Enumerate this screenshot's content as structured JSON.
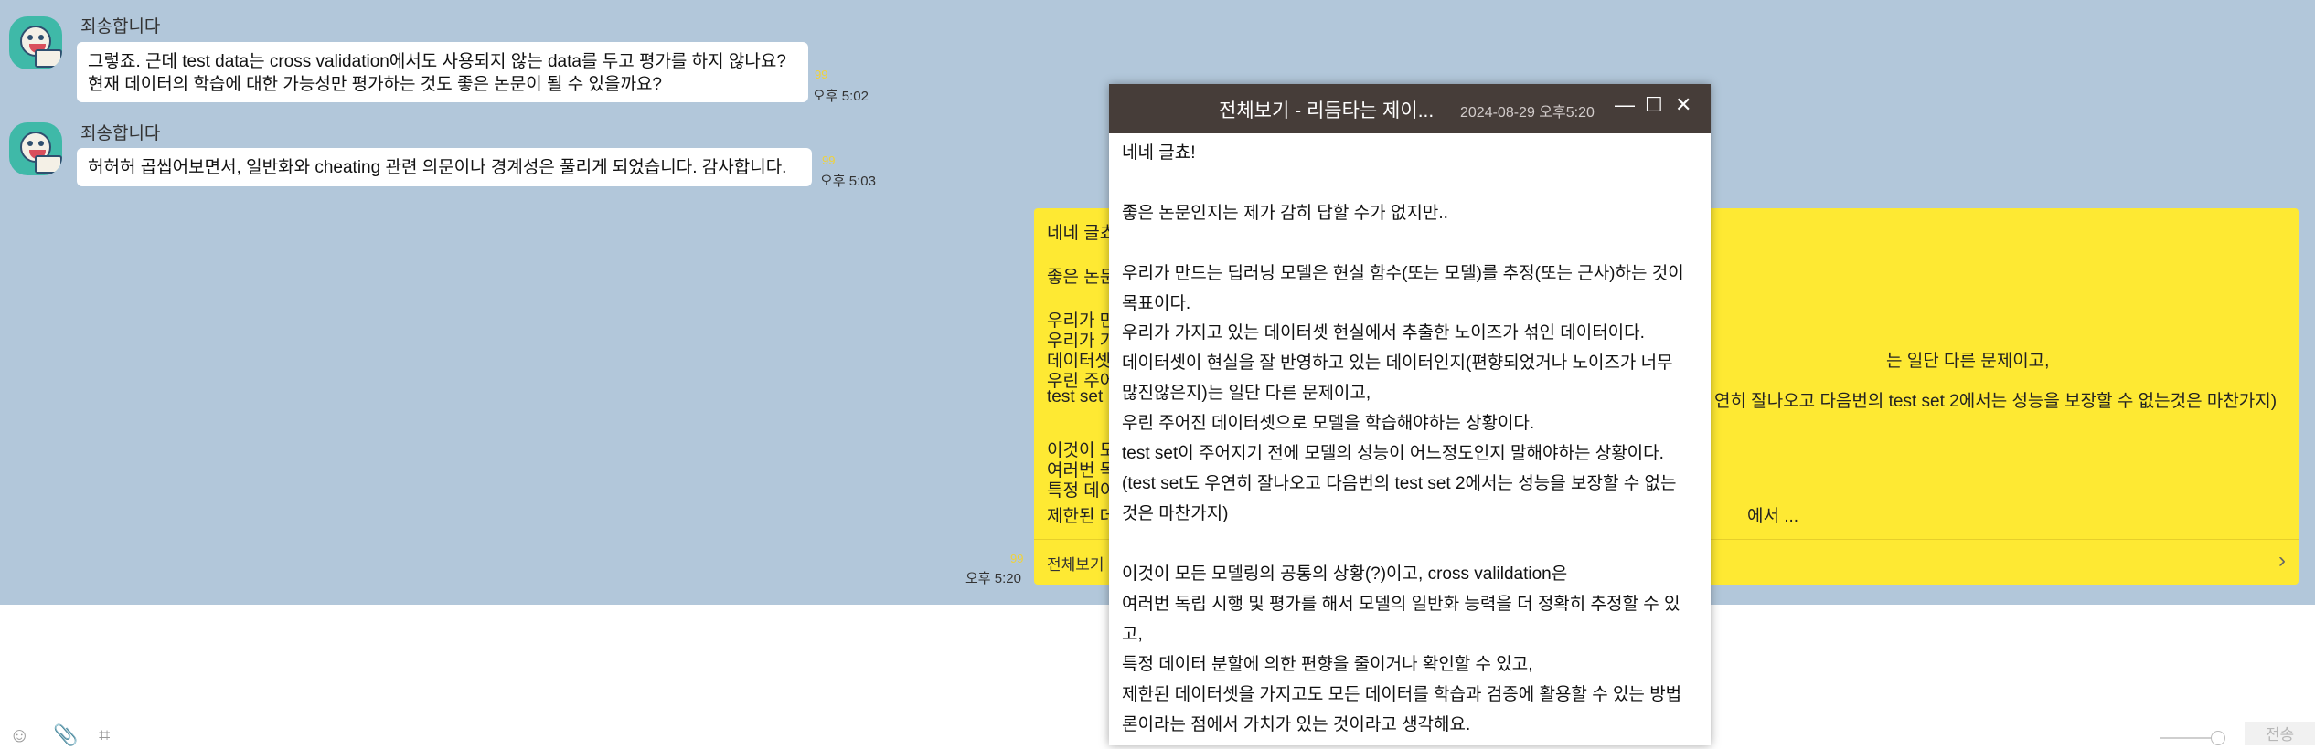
{
  "messages": [
    {
      "sender": "죄송합니다",
      "lines": [
        "그렇죠. 근데 test data는 cross validation에서도 사용되지 않는 data를 두고 평가를 하지 않나요?",
        "현재 데이터의 학습에 대한 가능성만 평가하는 것도 좋은 논문이 될 수 있을까요?"
      ],
      "read_mark": "99",
      "time": "오후 5:02"
    },
    {
      "sender": "죄송합니다",
      "lines": [
        "허허허 곱씹어보면서, 일반화와 cheating 관련 의문이나 경계성은 풀리게 되었습니다. 감사합니다."
      ],
      "read_mark": "99",
      "time": "오후 5:03"
    }
  ],
  "my_message": {
    "read_mark": "99",
    "time": "오후 5:20",
    "lines": [
      "네네 글쵸!",
      "좋은 논문",
      "우리가 만",
      "우리가 가",
      "데이터셋",
      "우린 주어",
      "test set",
      "이것이 모",
      "여러번 독",
      "특정 데이",
      "제한된 데"
    ],
    "visible_tails": [
      "는 일단 다른 문제이고,",
      "연히 잘나오고 다음번의 test set 2에서는 성능을 보장할 수 없는것은 마찬가지)",
      "에서 ..."
    ],
    "view_all_label": "전체보기",
    "chevron": "›"
  },
  "toolbar": {
    "icons": [
      "emoji-icon",
      "attach-icon",
      "crop-icon"
    ],
    "send_label": "전송"
  },
  "viewer": {
    "title": "전체보기 - 리듬타는 제이...",
    "date": "2024-08-29 오후5:20",
    "window_buttons": [
      "—",
      "☐",
      "✕"
    ],
    "lines": [
      "네네 글쵸!",
      "",
      "좋은 논문인지는 제가 감히 답할 수가 없지만..",
      "",
      "우리가 만드는 딥러닝 모델은 현실 함수(또는 모델)를 추정(또는 근사)하는 것이",
      "목표이다.",
      "우리가 가지고 있는 데이터셋 현실에서 추출한 노이즈가 섞인 데이터이다.",
      "데이터셋이 현실을 잘 반영하고 있는 데이터인지(편향되었거나 노이즈가 너무",
      "많진않은지)는 일단 다른 문제이고,",
      "우린 주어진 데이터셋으로 모델을 학습해야하는 상황이다.",
      "test set이 주어지기 전에 모델의 성능이 어느정도인지 말해야하는 상황이다.",
      "(test set도 우연히 잘나오고 다음번의 test set 2에서는 성능을 보장할 수 없는",
      "것은 마찬가지)",
      "",
      "이것이 모든 모델링의 공통의 상황(?)이고, cross valildation은",
      "여러번 독립 시행 및 평가를 해서 모델의 일반화 능력을 더 정확히 추정할 수 있",
      "고,",
      "특정 데이터 분할에 의한 편향을 줄이거나 확인할 수 있고,",
      "제한된 데이터셋을 가지고도 모든 데이터를 학습과 검증에 활용할 수 있는 방법",
      "론이라는 점에서 가치가 있는 것이라고 생각해요."
    ]
  },
  "colors": {
    "chat_bg": "#b2c7da",
    "my_bubble": "#fee933",
    "viewer_titlebar": "#463d39"
  }
}
